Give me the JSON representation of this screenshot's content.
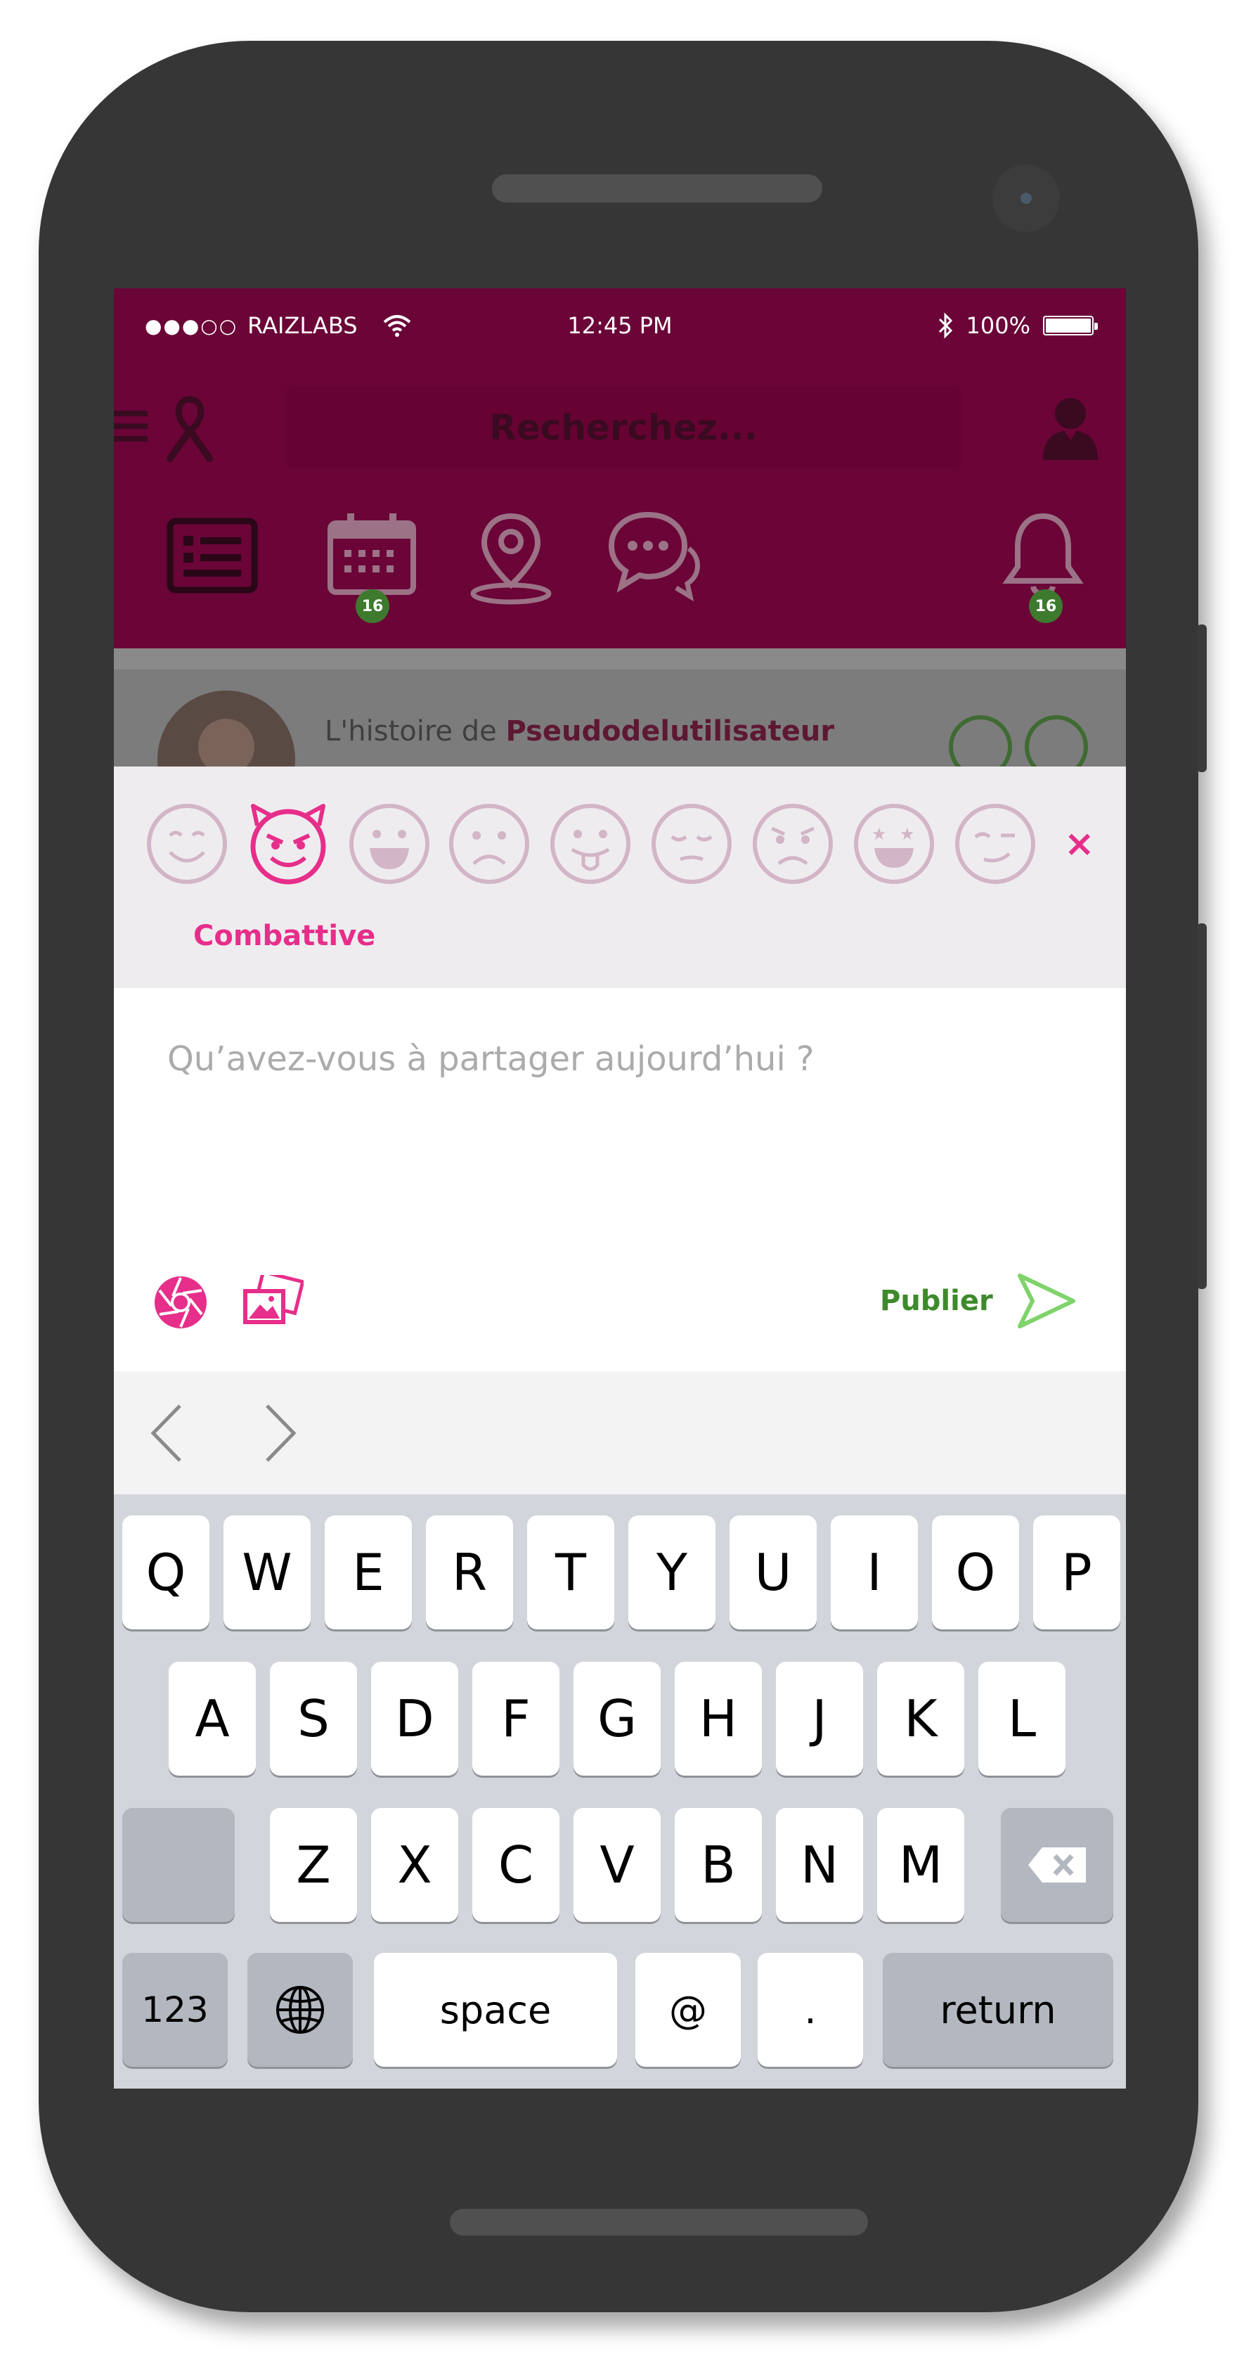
{
  "status_bar": {
    "signal_dots": "●●●○○",
    "carrier": "RAIZLABS",
    "time": "12:45 PM",
    "battery": "100%"
  },
  "header": {
    "search_placeholder": "Recherchez...",
    "calendar_badge": "16",
    "notifications_badge": "16"
  },
  "feed": {
    "prefix": "L'histoire de",
    "username": "Pseudodelutilisateur"
  },
  "mood": {
    "selected_label": "Combattive",
    "selected_index": 1,
    "icons": [
      "smile-icon",
      "devil-icon",
      "grin-icon",
      "sad-icon",
      "tongue-icon",
      "sleepy-icon",
      "frown-icon",
      "star-eyes-icon",
      "wink-icon"
    ],
    "close": "×"
  },
  "composer": {
    "placeholder": "Qu’avez-vous à partager aujourd’hui ?",
    "publish_label": "Publier"
  },
  "keyboard": {
    "row1": [
      "Q",
      "W",
      "E",
      "R",
      "T",
      "Y",
      "U",
      "I",
      "O",
      "P"
    ],
    "row2": [
      "A",
      "S",
      "D",
      "F",
      "G",
      "H",
      "J",
      "K",
      "L"
    ],
    "row3": [
      "Z",
      "X",
      "C",
      "V",
      "B",
      "N",
      "M"
    ],
    "numbers": "123",
    "space": "space",
    "at": "@",
    "dot": ".",
    "return": "return"
  },
  "colors": {
    "header": "#6b0437",
    "accent": "#e62e8a",
    "publish": "#3d8a2a",
    "mood_inactive": "#d2b5c6"
  }
}
